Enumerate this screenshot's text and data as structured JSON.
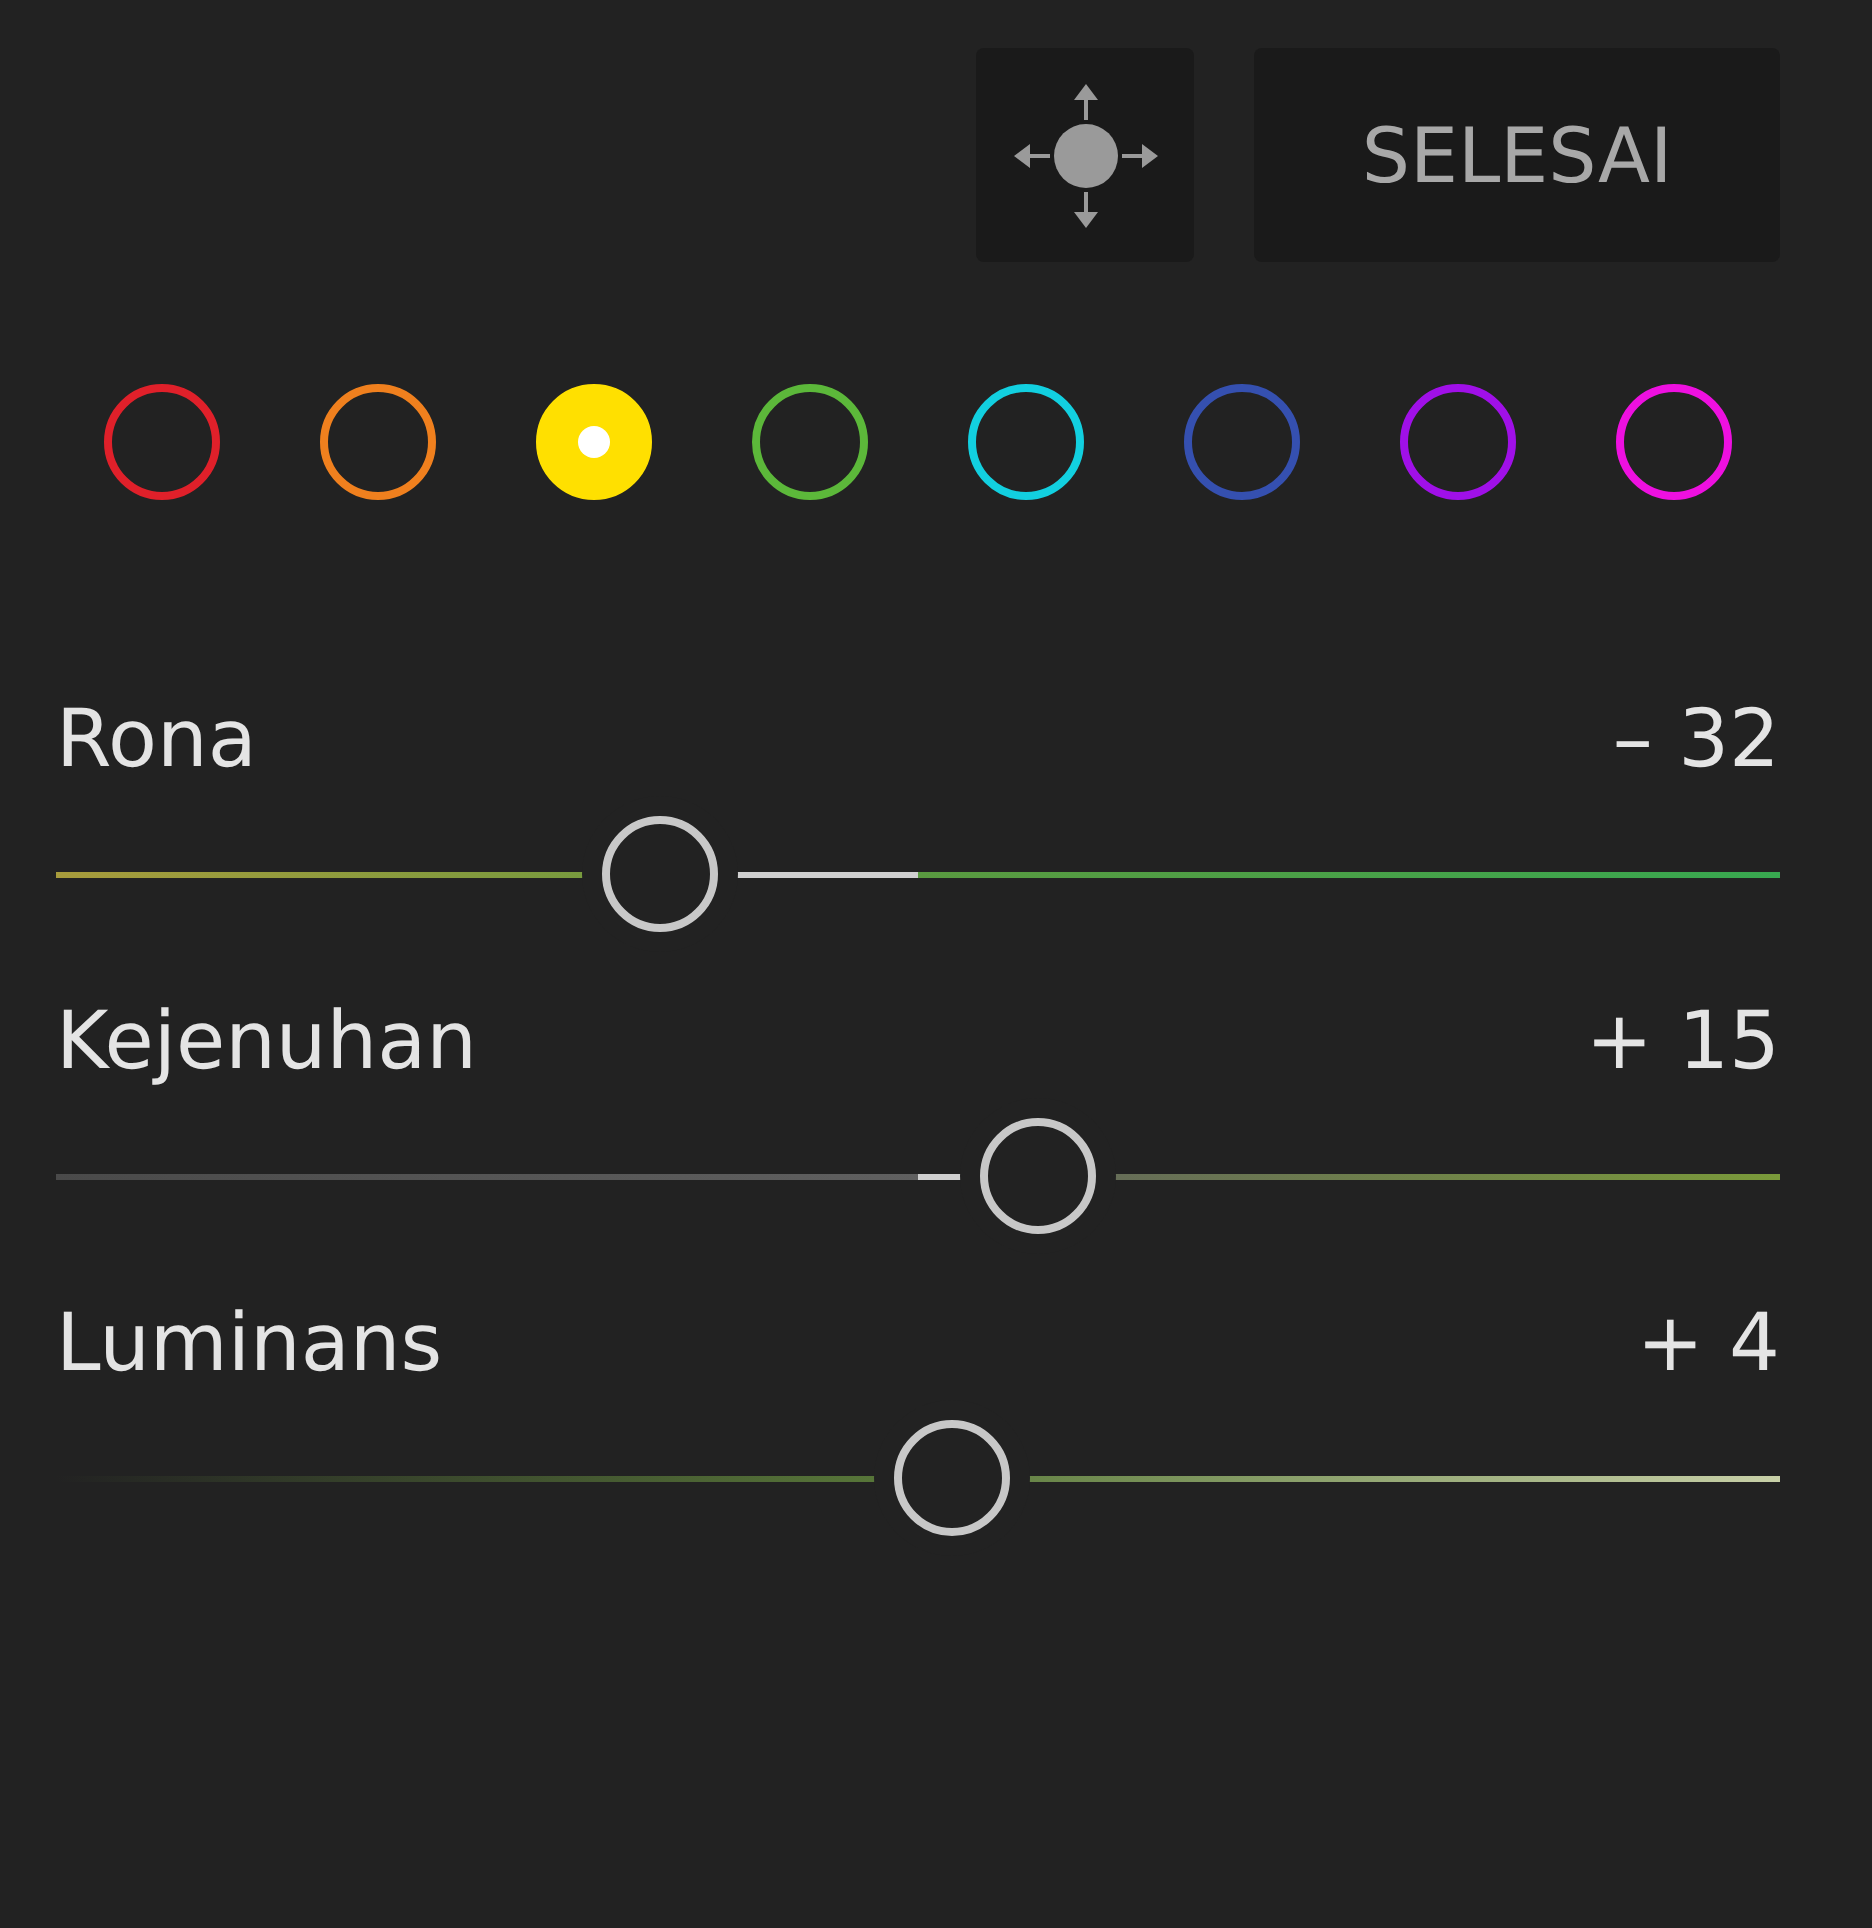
{
  "toolbar": {
    "done_button": "SELESAI"
  },
  "color_swatches": [
    {
      "color": "#e0202a",
      "selected": false
    },
    {
      "color": "#f0801e",
      "selected": false
    },
    {
      "color": "#ffe000",
      "selected": true
    },
    {
      "color": "#5cb83a",
      "selected": false
    },
    {
      "color": "#12d0e0",
      "selected": false
    },
    {
      "color": "#3550b0",
      "selected": false
    },
    {
      "color": "#a010e8",
      "selected": false
    },
    {
      "color": "#ee10e0",
      "selected": false
    }
  ],
  "sliders": [
    {
      "label": "Rona",
      "reading": "– 32",
      "level": 0.35
    },
    {
      "label": "Kejenuhan",
      "reading": "+ 15",
      "level": 0.57
    },
    {
      "label": "Luminans",
      "reading": "+ 4",
      "level": 0.52
    }
  ]
}
